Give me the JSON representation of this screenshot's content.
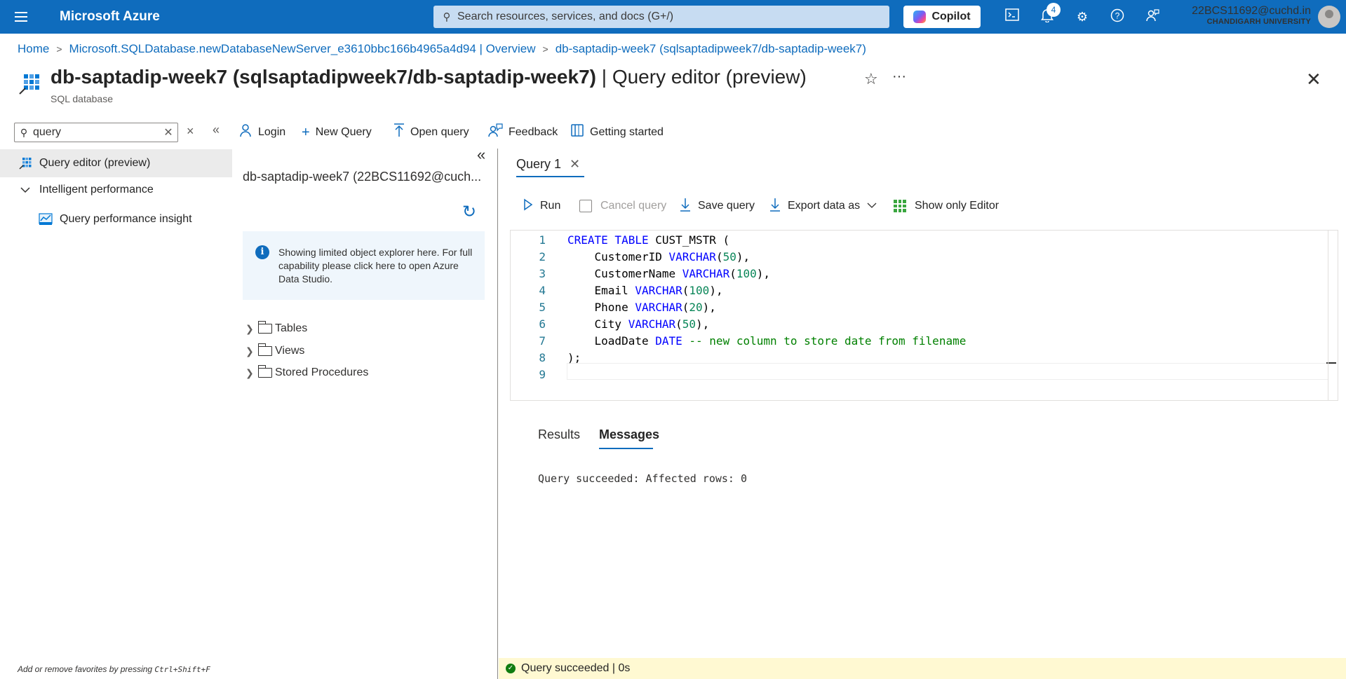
{
  "topbar": {
    "brand": "Microsoft Azure",
    "search_placeholder": "Search resources, services, and docs (G+/)",
    "copilot_label": "Copilot",
    "notification_count": "4",
    "account_email": "22BCS11692@cuchd.in",
    "account_org": "CHANDIGARH UNIVERSITY",
    "brand_color": "#0f6cbd"
  },
  "breadcrumb": {
    "items": [
      "Home",
      "Microsoft.SQLDatabase.newDatabaseNewServer_e3610bbc166b4965a4d94 | Overview",
      "db-saptadip-week7 (sqlsaptadipweek7/db-saptadip-week7)"
    ]
  },
  "page": {
    "title_main": "db-saptadip-week7 (sqlsaptadipweek7/db-saptadip-week7)",
    "title_section": "| Query editor (preview)",
    "subtitle": "SQL database"
  },
  "nav": {
    "search_value": "query",
    "items": [
      {
        "label": "Query editor (preview)",
        "icon": "query-editor-icon"
      },
      {
        "label": "Intelligent performance",
        "icon": "chevron-down-icon"
      },
      {
        "label": "Query performance insight",
        "icon": "performance-insight-icon"
      }
    ],
    "footer_prefix": "Add or remove favorites by pressing ",
    "footer_shortcut": "Ctrl+Shift+F"
  },
  "commandbar": {
    "login": "Login",
    "new_query": "New Query",
    "open_query": "Open query",
    "feedback": "Feedback",
    "getting_started": "Getting started"
  },
  "explorer": {
    "connection": "db-saptadip-week7 (22BCS11692@cuch...",
    "info_text": "Showing limited object explorer here. For full capability please click here to open Azure Data Studio.",
    "tree": [
      "Tables",
      "Views",
      "Stored Procedures"
    ]
  },
  "editor": {
    "tab_label": "Query 1",
    "toolbar": {
      "run": "Run",
      "cancel": "Cancel query",
      "save": "Save query",
      "export": "Export data as",
      "show_only": "Show only Editor"
    },
    "line_numbers": [
      "1",
      "2",
      "3",
      "4",
      "5",
      "6",
      "7",
      "8",
      "9"
    ],
    "code": {
      "l1_kw": "CREATE TABLE",
      "l1_rest": " CUST_MSTR (",
      "l2_name": "    CustomerID ",
      "l2_type": "VARCHAR",
      "l2_num": "50",
      "l3_name": "    CustomerName ",
      "l3_type": "VARCHAR",
      "l3_num": "100",
      "l4_name": "    Email ",
      "l4_type": "VARCHAR",
      "l4_num": "100",
      "l5_name": "    Phone ",
      "l5_type": "VARCHAR",
      "l5_num": "20",
      "l6_name": "    City ",
      "l6_type": "VARCHAR",
      "l6_num": "50",
      "l7_name": "    LoadDate ",
      "l7_type": "DATE",
      "l7_comment": " -- new column to store date from filename",
      "l8": ");"
    }
  },
  "results": {
    "tab_results": "Results",
    "tab_messages": "Messages",
    "message": "Query succeeded: Affected rows: 0"
  },
  "status": {
    "text": "Query succeeded | 0s",
    "color": "#fff9d2"
  }
}
